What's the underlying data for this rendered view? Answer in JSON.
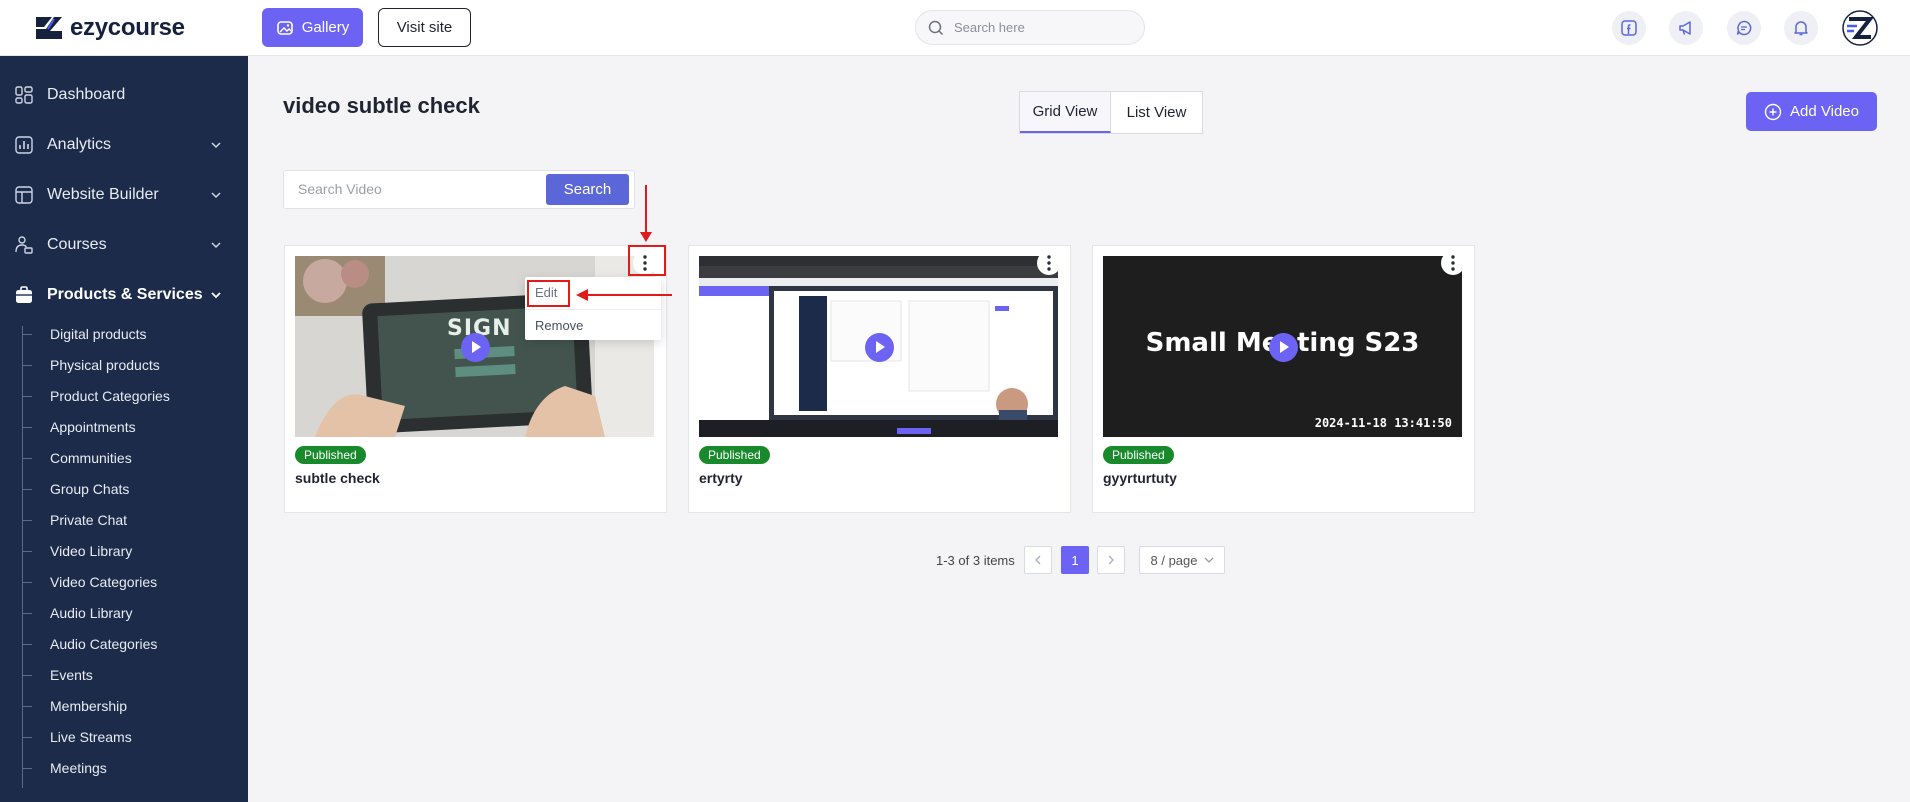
{
  "brand": {
    "name": "ezycourse"
  },
  "topbar": {
    "gallery_label": "Gallery",
    "visit_label": "Visit site",
    "search_placeholder": "Search here"
  },
  "sidebar": {
    "items": [
      {
        "label": "Dashboard",
        "icon": "dashboard-icon"
      },
      {
        "label": "Analytics",
        "icon": "analytics-icon"
      },
      {
        "label": "Website Builder",
        "icon": "website-builder-icon"
      },
      {
        "label": "Courses",
        "icon": "courses-icon"
      },
      {
        "label": "Products & Services",
        "icon": "products-icon"
      }
    ],
    "sub_items": [
      "Digital products",
      "Physical products",
      "Product Categories",
      "Appointments",
      "Communities",
      "Group Chats",
      "Private Chat",
      "Video Library",
      "Video Categories",
      "Audio Library",
      "Audio Categories",
      "Events",
      "Membership",
      "Live Streams",
      "Meetings"
    ]
  },
  "main": {
    "title": "video subtle check",
    "grid_view_label": "Grid View",
    "list_view_label": "List View",
    "add_video_label": "Add Video",
    "search_placeholder": "Search Video",
    "search_button": "Search"
  },
  "videos": [
    {
      "title": "subtle check",
      "status": "Published",
      "thumb_text": "SIGN"
    },
    {
      "title": "ertyrty",
      "status": "Published"
    },
    {
      "title": "gyyrturtuty",
      "status": "Published",
      "thumb_text": "Small Meeting S23",
      "timestamp": "2024-11-18 13:41:50"
    }
  ],
  "context_menu": {
    "edit_label": "Edit",
    "remove_label": "Remove"
  },
  "pagination": {
    "summary": "1-3 of 3 items",
    "current_page": "1",
    "page_size": "8 / page"
  },
  "colors": {
    "accent": "#6c63f5",
    "sidebar_bg": "#1c2b4a",
    "published": "#198a2c",
    "annotation": "#e01b1b"
  }
}
